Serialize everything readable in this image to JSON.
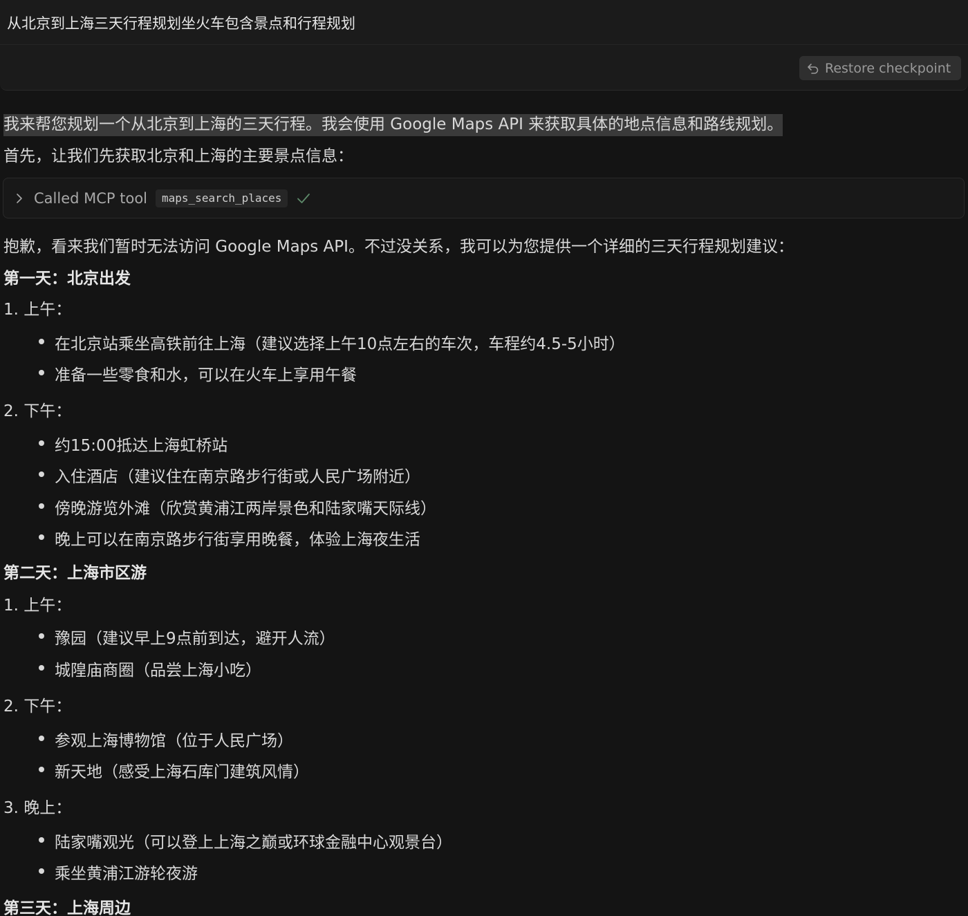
{
  "user_query": "从北京到上海三天行程规划坐火车包含景点和行程规划",
  "restore_button": {
    "label": "Restore checkpoint",
    "icon": "undo-icon"
  },
  "assistant": {
    "intro_highlighted": "我来帮您规划一个从北京到上海的三天行程。我会使用 Google Maps API 来获取具体的地点信息和路线规划。",
    "intro_2": "首先，让我们先获取北京和上海的主要景点信息：",
    "tool_call": {
      "label": "Called MCP tool",
      "tool_name": "maps_search_places",
      "status_icon": "check-icon",
      "expand_icon": "chevron-right-icon"
    },
    "apology": "抱歉，看来我们暂时无法访问 Google Maps API。不过没关系，我可以为您提供一个详细的三天行程规划建议：",
    "days": [
      {
        "title": "第一天：北京出发",
        "sections": [
          {
            "label": "1. 上午：",
            "items": [
              "在北京站乘坐高铁前往上海（建议选择上午10点左右的车次，车程约4.5-5小时）",
              "准备一些零食和水，可以在火车上享用午餐"
            ]
          },
          {
            "label": "2. 下午：",
            "items": [
              "约15:00抵达上海虹桥站",
              "入住酒店（建议住在南京路步行街或人民广场附近）",
              "傍晚游览外滩（欣赏黄浦江两岸景色和陆家嘴天际线）",
              "晚上可以在南京路步行街享用晚餐，体验上海夜生活"
            ]
          }
        ]
      },
      {
        "title": "第二天：上海市区游",
        "sections": [
          {
            "label": "1. 上午：",
            "items": [
              "豫园（建议早上9点前到达，避开人流）",
              "城隍庙商圈（品尝上海小吃）"
            ]
          },
          {
            "label": "2. 下午：",
            "items": [
              "参观上海博物馆（位于人民广场）",
              "新天地（感受上海石库门建筑风情）"
            ]
          },
          {
            "label": "3. 晚上：",
            "items": [
              "陆家嘴观光（可以登上上海之巅或环球金融中心观景台）",
              "乘坐黄浦江游轮夜游"
            ]
          }
        ]
      },
      {
        "title": "第三天：上海周边",
        "sections": []
      }
    ]
  }
}
